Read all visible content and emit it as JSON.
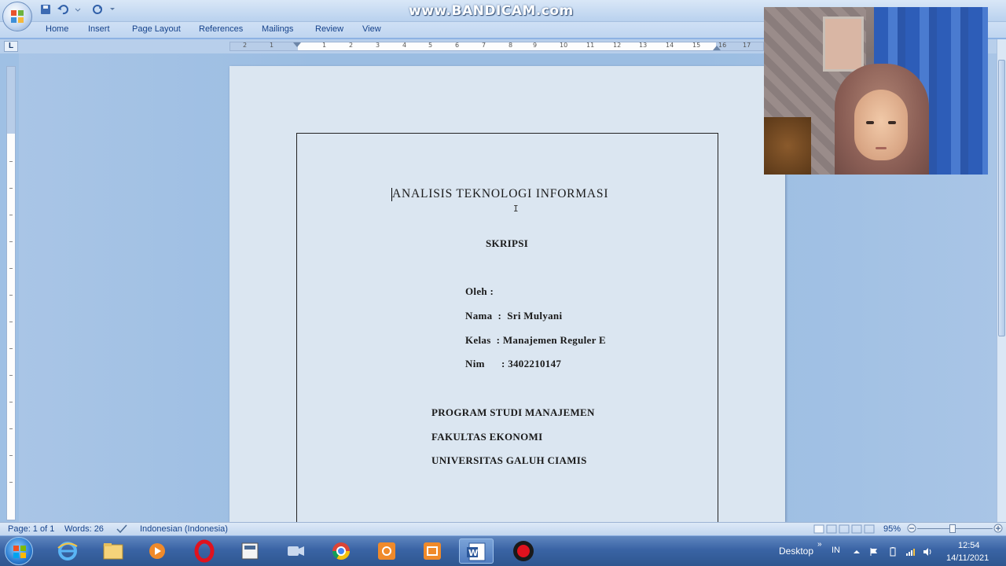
{
  "app": {
    "watermark": "www.BANDICAM.com"
  },
  "ribbon": {
    "tabs": [
      "Home",
      "Insert",
      "Page Layout",
      "References",
      "Mailings",
      "Review",
      "View"
    ]
  },
  "ruler": {
    "corner_label": "L",
    "numbers": [
      "2",
      "1",
      "1",
      "2",
      "3",
      "4",
      "5",
      "6",
      "7",
      "8",
      "9",
      "10",
      "11",
      "12",
      "13",
      "14",
      "15",
      "16",
      "17"
    ]
  },
  "document": {
    "title": "ANALISIS TEKNOLOGI INFORMASI",
    "subtitle": "SKRIPSI",
    "oleh": "Oleh :",
    "nama": "Nama  :  Sri Mulyani",
    "kelas": "Kelas  : Manajemen Reguler E",
    "nim": "Nim      : 3402210147",
    "program": "PROGRAM STUDI MANAJEMEN",
    "fakultas": "FAKULTAS EKONOMI",
    "universitas": "UNIVERSITAS GALUH CIAMIS"
  },
  "statusbar": {
    "page": "Page: 1 of 1",
    "words": "Words: 26",
    "language": "Indonesian (Indonesia)",
    "zoom": "95%"
  },
  "taskbar": {
    "desktop_label": "Desktop",
    "lang_indicator": "IN",
    "time": "12:54",
    "date": "14/11/2021"
  }
}
